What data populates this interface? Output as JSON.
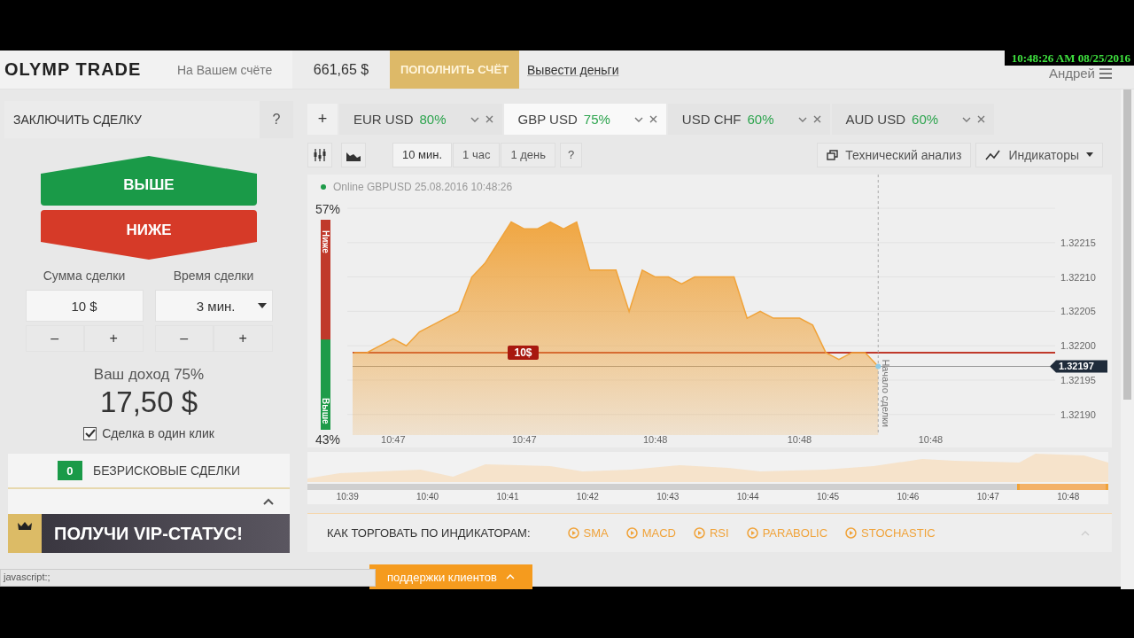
{
  "clock": "10:48:26 AM 08/25/2016",
  "header": {
    "logo": "OLYMP TRADE",
    "balance_label": "На Вашем счёте",
    "balance": "661,65 $",
    "deposit_button": "ПОПОЛНИТЬ СЧЁТ",
    "withdraw_link": "Вывести деньги",
    "user": "Андрей"
  },
  "trade_panel": {
    "title": "ЗАКЛЮЧИТЬ СДЕЛКУ",
    "help": "?",
    "up_button": "ВЫШЕ",
    "down_button": "НИЖЕ",
    "amount_label": "Сумма сделки",
    "amount_value": "10 $",
    "amount_stepper": [
      "–",
      "+"
    ],
    "time_label": "Время сделки",
    "time_value": "3 мин.",
    "time_stepper": [
      "–",
      "+"
    ],
    "income_label": "Ваш доход 75%",
    "income_value": "17,50 $",
    "one_click": {
      "label": "Сделка в один клик",
      "checked": true
    },
    "risk_free": {
      "count": "0",
      "label": "БЕЗРИСКОВЫЕ СДЕЛКИ"
    },
    "vip_banner": "ПОЛУЧИ VIP-СТАТУС!"
  },
  "asset_tabs": {
    "add": "+",
    "tabs": [
      {
        "name": "EUR USD",
        "payout": "80%",
        "selected": false
      },
      {
        "name": "GBP USD",
        "payout": "75%",
        "selected": true
      },
      {
        "name": "USD CHF",
        "payout": "60%",
        "selected": false
      },
      {
        "name": "AUD USD",
        "payout": "60%",
        "selected": false
      }
    ]
  },
  "toolbar": {
    "periods": [
      {
        "label": "10 мин.",
        "selected": true
      },
      {
        "label": "1 час",
        "selected": false
      },
      {
        "label": "1 день",
        "selected": false
      }
    ],
    "help": "?",
    "analysis_button": "Технический анализ",
    "indicators_button": "Индикаторы"
  },
  "chart_panel": {
    "status": "Online GBPUSD 25.08.2016 10:48:26",
    "sentiment": {
      "down_percent": "57%",
      "down_label": "Ниже",
      "up_label": "Выше",
      "up_percent": "43%",
      "level": 0.57
    },
    "trade_marker": "10$",
    "current_price": "1.32197",
    "start_label": "Начало сделки",
    "chart_data": {
      "type": "area",
      "categories": [
        null,
        null,
        null,
        "10:47",
        null,
        null,
        null,
        null,
        null,
        null,
        null,
        null,
        null,
        "10:47",
        null,
        null,
        null,
        null,
        null,
        null,
        null,
        null,
        null,
        "10:48",
        null,
        null,
        null,
        null,
        null,
        null,
        null,
        null,
        null,
        null,
        "10:48",
        null,
        null,
        null,
        null,
        null,
        null,
        null,
        null,
        null,
        "10:48",
        null,
        null,
        null,
        null,
        null,
        null,
        null,
        null,
        null
      ],
      "series": [
        {
          "color": "#f0a33a",
          "values": [
            1.32199,
            1.32199,
            1.322,
            1.32201,
            1.322,
            1.32202,
            1.32203,
            1.32204,
            1.32205,
            1.3221,
            1.32212,
            1.32215,
            1.32218,
            1.32217,
            1.32217,
            1.32218,
            1.32217,
            1.32218,
            1.32211,
            1.32211,
            1.32211,
            1.32205,
            1.32211,
            1.3221,
            1.3221,
            1.32209,
            1.3221,
            1.3221,
            1.3221,
            1.3221,
            1.32204,
            1.32205,
            1.32204,
            1.32204,
            1.32204,
            1.32203,
            1.32199,
            1.32198,
            1.32199,
            1.32199,
            1.32197,
            null,
            null,
            null,
            null,
            null,
            null,
            null,
            null,
            null,
            null,
            null,
            null,
            null
          ]
        }
      ],
      "ylim": [
        1.32187,
        1.3222
      ],
      "grid": true,
      "yticks": [
        {
          "value": 1.3219,
          "label": "1.32190"
        },
        {
          "value": 1.32195,
          "label": "1.32195"
        },
        {
          "value": 1.322,
          "label": "1.32200"
        },
        {
          "value": 1.32205,
          "label": "1.32205"
        },
        {
          "value": 1.3221,
          "label": "1.32210"
        },
        {
          "value": 1.32215,
          "label": "1.32215"
        }
      ]
    }
  },
  "navigator": {
    "times": [
      "10:39",
      "10:40",
      "10:41",
      "10:42",
      "10:43",
      "10:44",
      "10:45",
      "10:46",
      "10:47",
      "10:48"
    ]
  },
  "indicators": {
    "title": "КАК ТОРГОВАТЬ ПО ИНДИКАТОРАМ:",
    "links": [
      "SMA",
      "MACD",
      "RSI",
      "PARABOLIC",
      "STOCHASTIC"
    ]
  },
  "support_bar": "поддержки клиентов",
  "status_tooltip": "javascript:;"
}
